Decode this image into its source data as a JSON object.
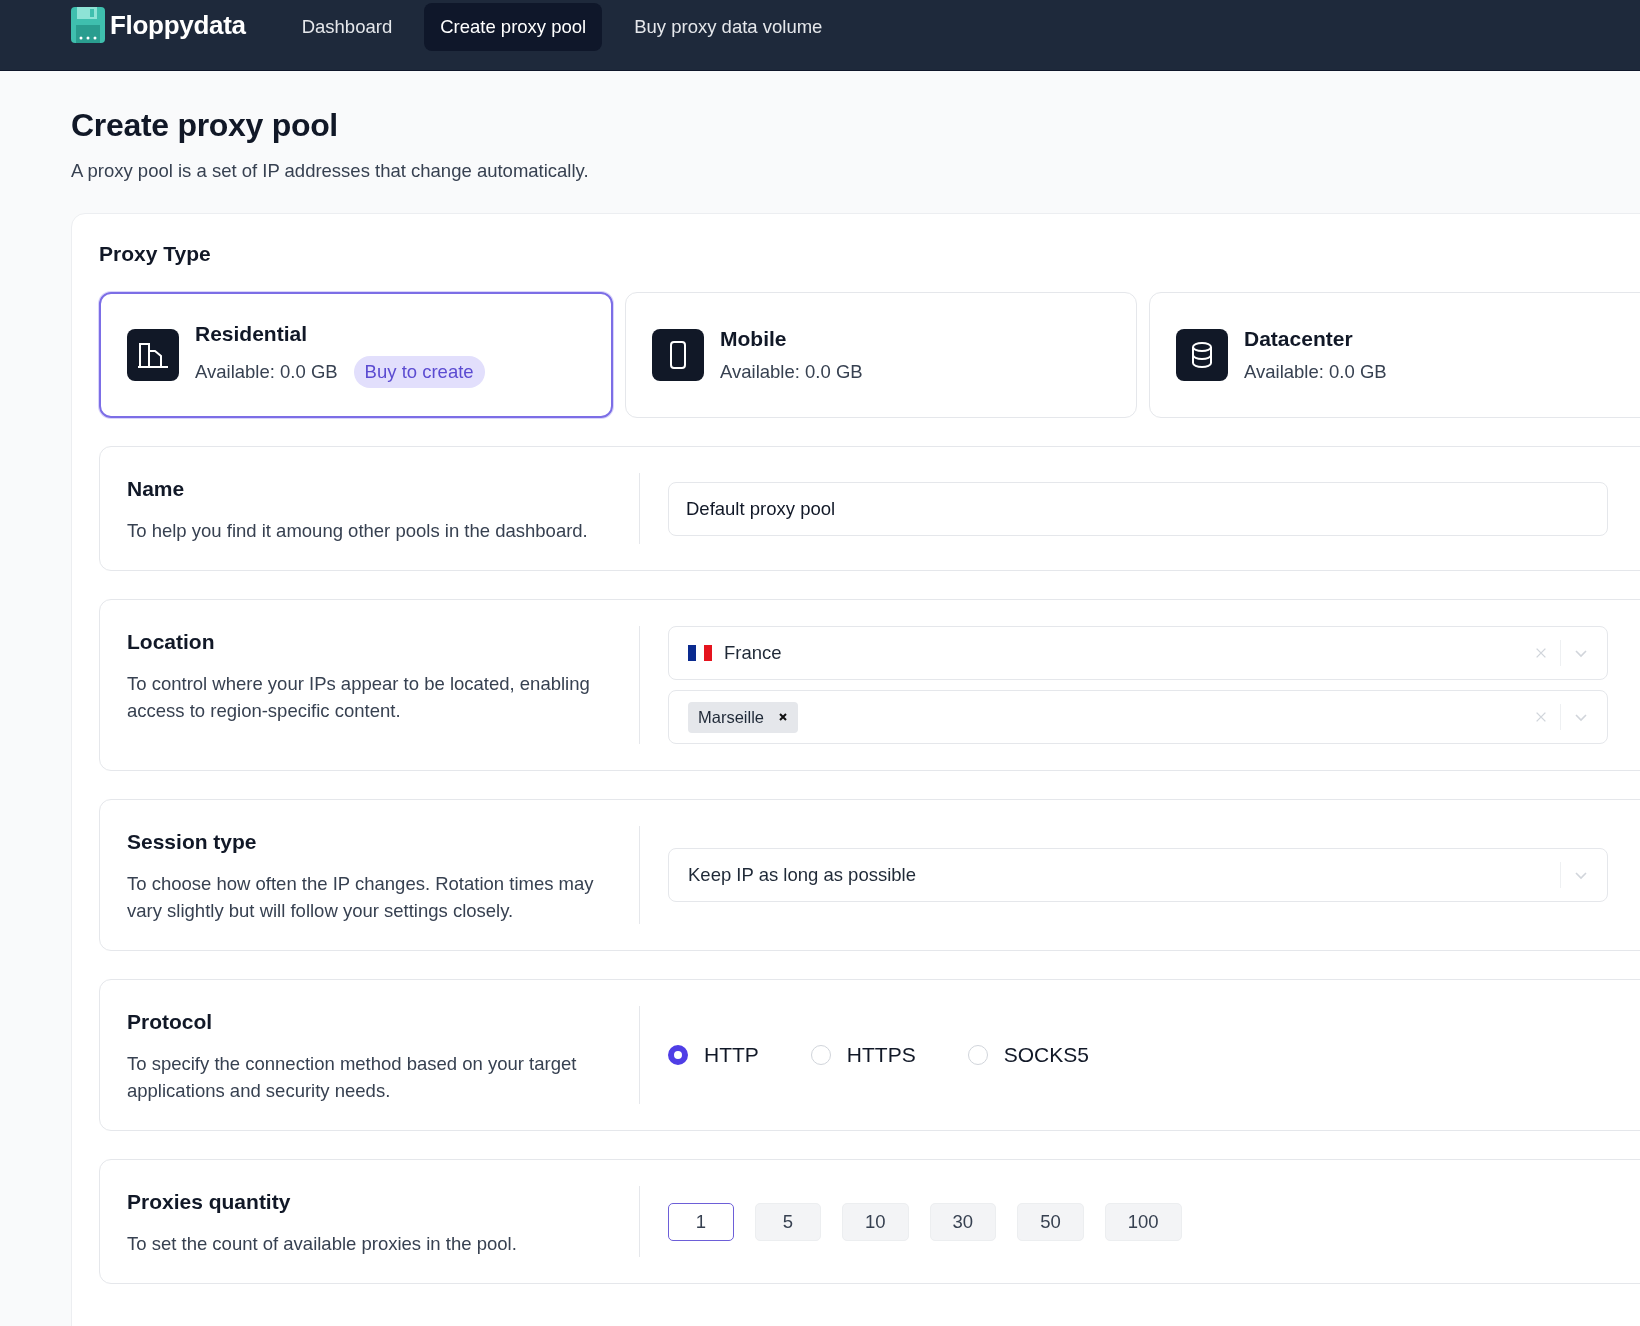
{
  "nav": {
    "brand": "Floppydata",
    "links": [
      {
        "label": "Dashboard",
        "selected": false
      },
      {
        "label": "Create proxy pool",
        "selected": true
      },
      {
        "label": "Buy proxy data volume",
        "selected": false
      }
    ]
  },
  "page": {
    "title": "Create proxy pool",
    "subtitle": "A proxy pool is a set of IP addresses that change automatically."
  },
  "proxy_type": {
    "heading": "Proxy Type",
    "options": [
      {
        "kind": "residential",
        "name": "Residential",
        "available": "Available: 0.0 GB",
        "badge": "Buy to create",
        "selected": true
      },
      {
        "kind": "mobile",
        "name": "Mobile",
        "available": "Available: 0.0 GB",
        "selected": false
      },
      {
        "kind": "datacenter",
        "name": "Datacenter",
        "available": "Available: 0.0 GB",
        "selected": false
      }
    ]
  },
  "sections": [
    {
      "kind": "text",
      "title": "Name",
      "description": "To help you find it amoung other pools in the dashboard.",
      "value": "Default proxy pool"
    },
    {
      "kind": "location",
      "title": "Location",
      "description": "To control where your IPs appear to be located, enabling access to region-specific content.",
      "country": "France",
      "cities": [
        "Marseille"
      ]
    },
    {
      "kind": "select",
      "title": "Session type",
      "description": "To choose how often the IP changes. Rotation times may vary slightly but will follow your settings closely.",
      "value": "Keep IP as long as possible"
    },
    {
      "kind": "radio",
      "title": "Protocol",
      "description": "To specify the connection method based on your target applications and security needs.",
      "options": [
        {
          "label": "HTTP",
          "selected": true
        },
        {
          "label": "HTTPS",
          "selected": false
        },
        {
          "label": "SOCKS5",
          "selected": false
        }
      ]
    },
    {
      "kind": "chips",
      "title": "Proxies quantity",
      "description": "To set the count of available proxies in the pool.",
      "options": [
        {
          "label": "1",
          "selected": true
        },
        {
          "label": "5",
          "selected": false
        },
        {
          "label": "10",
          "selected": false
        },
        {
          "label": "30",
          "selected": false
        },
        {
          "label": "50",
          "selected": false
        },
        {
          "label": "100",
          "selected": false
        }
      ]
    }
  ]
}
